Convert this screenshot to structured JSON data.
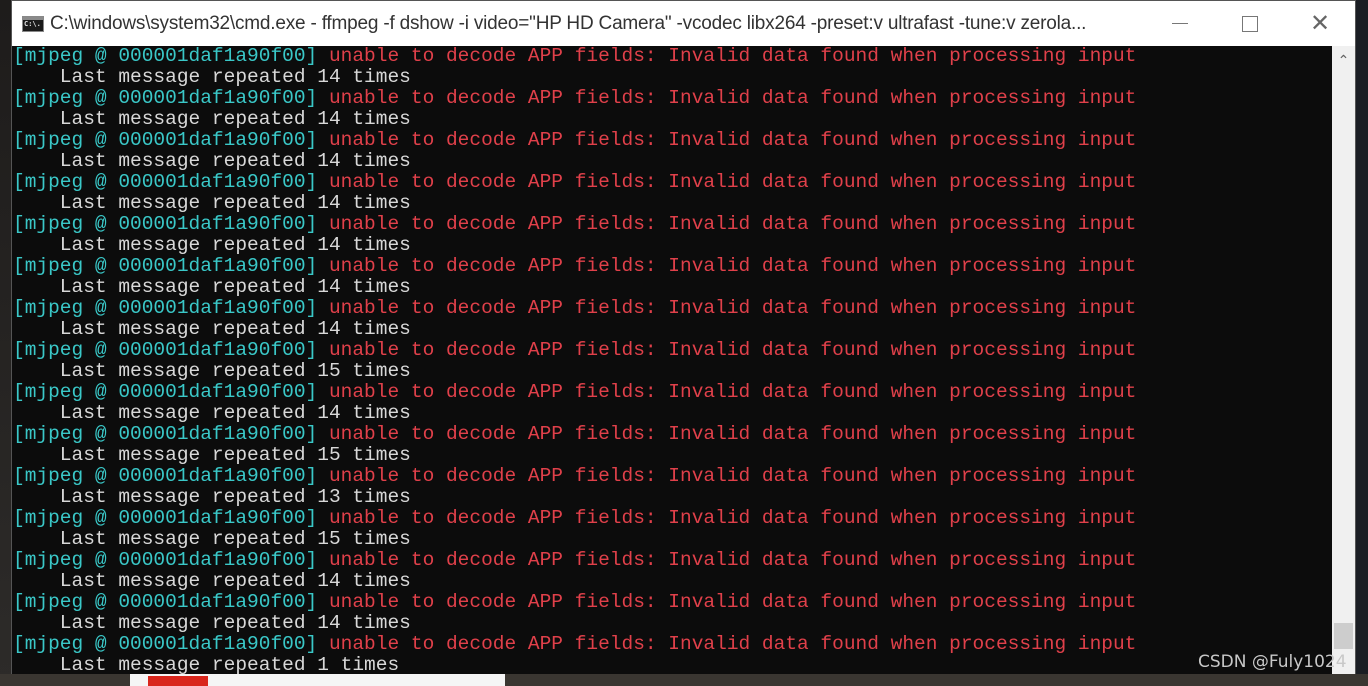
{
  "window": {
    "title": "C:\\windows\\system32\\cmd.exe - ffmpeg  -f dshow -i video=\"HP HD Camera\" -vcodec libx264 -preset:v ultrafast -tune:v zerola...",
    "controls": {
      "minimize": "minimize",
      "maximize": "maximize",
      "close": "close"
    }
  },
  "console": {
    "colors": {
      "tag": "#3ac8c8",
      "error": "#e0404a",
      "text": "#d8d8d8",
      "background": "#0c0c0c"
    },
    "entries": [
      {
        "tag": "[mjpeg @ 000001daf1a90f00]",
        "message": " unable to decode APP fields: Invalid data found when processing input",
        "repeat": "    Last message repeated 14 times"
      },
      {
        "tag": "[mjpeg @ 000001daf1a90f00]",
        "message": " unable to decode APP fields: Invalid data found when processing input",
        "repeat": "    Last message repeated 14 times"
      },
      {
        "tag": "[mjpeg @ 000001daf1a90f00]",
        "message": " unable to decode APP fields: Invalid data found when processing input",
        "repeat": "    Last message repeated 14 times"
      },
      {
        "tag": "[mjpeg @ 000001daf1a90f00]",
        "message": " unable to decode APP fields: Invalid data found when processing input",
        "repeat": "    Last message repeated 14 times"
      },
      {
        "tag": "[mjpeg @ 000001daf1a90f00]",
        "message": " unable to decode APP fields: Invalid data found when processing input",
        "repeat": "    Last message repeated 14 times"
      },
      {
        "tag": "[mjpeg @ 000001daf1a90f00]",
        "message": " unable to decode APP fields: Invalid data found when processing input",
        "repeat": "    Last message repeated 14 times"
      },
      {
        "tag": "[mjpeg @ 000001daf1a90f00]",
        "message": " unable to decode APP fields: Invalid data found when processing input",
        "repeat": "    Last message repeated 14 times"
      },
      {
        "tag": "[mjpeg @ 000001daf1a90f00]",
        "message": " unable to decode APP fields: Invalid data found when processing input",
        "repeat": "    Last message repeated 15 times"
      },
      {
        "tag": "[mjpeg @ 000001daf1a90f00]",
        "message": " unable to decode APP fields: Invalid data found when processing input",
        "repeat": "    Last message repeated 14 times"
      },
      {
        "tag": "[mjpeg @ 000001daf1a90f00]",
        "message": " unable to decode APP fields: Invalid data found when processing input",
        "repeat": "    Last message repeated 15 times"
      },
      {
        "tag": "[mjpeg @ 000001daf1a90f00]",
        "message": " unable to decode APP fields: Invalid data found when processing input",
        "repeat": "    Last message repeated 13 times"
      },
      {
        "tag": "[mjpeg @ 000001daf1a90f00]",
        "message": " unable to decode APP fields: Invalid data found when processing input",
        "repeat": "    Last message repeated 15 times"
      },
      {
        "tag": "[mjpeg @ 000001daf1a90f00]",
        "message": " unable to decode APP fields: Invalid data found when processing input",
        "repeat": "    Last message repeated 14 times"
      },
      {
        "tag": "[mjpeg @ 000001daf1a90f00]",
        "message": " unable to decode APP fields: Invalid data found when processing input",
        "repeat": "    Last message repeated 14 times"
      },
      {
        "tag": "[mjpeg @ 000001daf1a90f00]",
        "message": " unable to decode APP fields: Invalid data found when processing input",
        "repeat": "    Last message repeated 1 times"
      }
    ]
  },
  "scrollbar": {
    "position": "bottom"
  },
  "watermark": "CSDN @Fuly1024"
}
